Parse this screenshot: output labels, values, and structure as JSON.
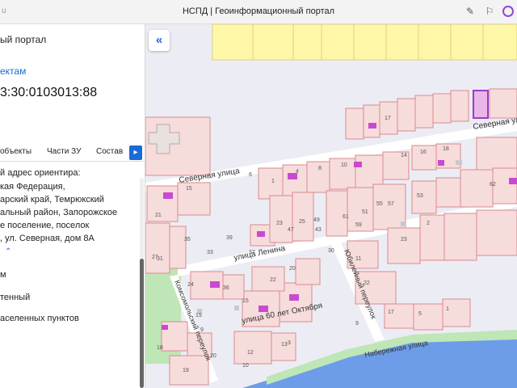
{
  "browser": {
    "url": "u",
    "tab_title": "НСПД | Геоинформационный портал",
    "icons": [
      "brush-icon",
      "bookmark-icon",
      "alice-assistant-icon"
    ]
  },
  "panel": {
    "title": "ый портал",
    "link": "ектам",
    "cadastral_number": "3:30:0103013:88",
    "tabs": [
      "объекты",
      "Части ЗУ",
      "Состав"
    ],
    "address_label": "й адрес ориентира:",
    "address_lines": [
      "кая Федерация,",
      "арский край, Темрюкский",
      "альный район, Запорожское",
      "е поселение, поселок",
      ", ул. Северная, дом 8А"
    ],
    "fields": [
      "м",
      "тенный",
      "аселенных пунктов"
    ]
  },
  "map": {
    "streets": [
      "Северная улица",
      "Северная улица",
      "улица Ленина",
      "улица 60 лет Октября",
      "Комсомольский переулок",
      "Юбилейный переулок",
      "Набережная улица"
    ],
    "house_numbers": [
      "15",
      "17",
      "1",
      "4",
      "8",
      "10",
      "14",
      "16",
      "18",
      "6",
      "21",
      "27",
      "23",
      "25",
      "49",
      "47",
      "43",
      "61",
      "51",
      "59",
      "53",
      "35",
      "55",
      "57",
      "62",
      "39",
      "31",
      "33",
      "37",
      "24",
      "36",
      "22",
      "20",
      "15",
      "19",
      "20",
      "9",
      "3",
      "12",
      "13",
      "18",
      "19",
      "10",
      "11",
      "30",
      "22",
      "23",
      "17",
      "5",
      "9",
      "1",
      "2"
    ],
    "colors": {
      "parcel_fill": "#f7dcdc",
      "parcel_stroke": "#d98b8b",
      "highlight_stroke": "#9b3cc6",
      "building_fill": "#c94ad1",
      "yellow_fill": "#fff7a8",
      "water": "#6d9de8",
      "green": "#bfe6b6",
      "street_text": "#333333"
    }
  }
}
